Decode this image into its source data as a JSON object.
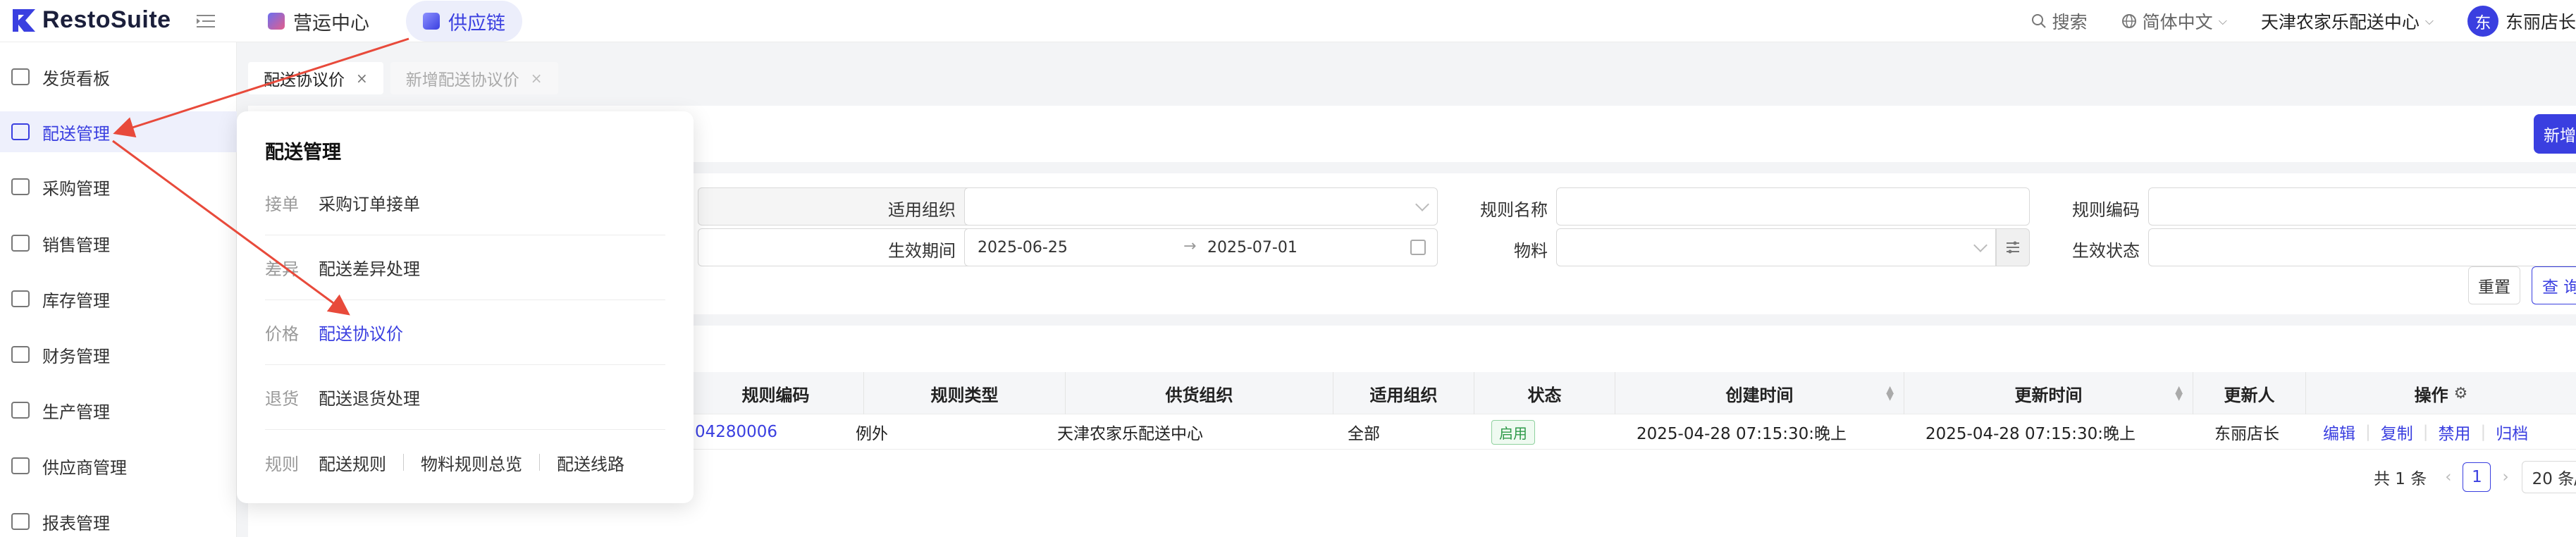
{
  "brand": {
    "name": "RestoSuite",
    "accent": "#3a3fe0"
  },
  "top_nav": [
    {
      "label": "营运中心",
      "icon": "operations-icon",
      "active": false
    },
    {
      "label": "供应链",
      "icon": "supply-chain-icon",
      "active": true
    }
  ],
  "top_right": {
    "search": "搜索",
    "language": "简体中文",
    "org": "天津农家乐配送中心",
    "avatar_char": "东",
    "user": "东丽店长"
  },
  "sidebar": {
    "items": [
      {
        "label": "发货看板",
        "icon": "monitor-icon"
      },
      {
        "label": "配送管理",
        "icon": "truck-icon",
        "active": true
      },
      {
        "label": "采购管理",
        "icon": "cart-icon"
      },
      {
        "label": "销售管理",
        "icon": "bag-icon"
      },
      {
        "label": "库存管理",
        "icon": "warehouse-icon"
      },
      {
        "label": "财务管理",
        "icon": "finance-icon"
      },
      {
        "label": "生产管理",
        "icon": "production-icon"
      },
      {
        "label": "供应商管理",
        "icon": "supplier-icon"
      },
      {
        "label": "报表管理",
        "icon": "report-icon"
      }
    ]
  },
  "tabs": [
    {
      "label": "配送协议价",
      "close": "×",
      "active": true
    },
    {
      "label": "新增配送协议价",
      "close": "×",
      "active": false
    }
  ],
  "new_button": "新增",
  "filters": {
    "apply_org_label": "适用组织",
    "rule_name_label": "规则名称",
    "rule_code_label": "规则编码",
    "effective_period_label": "生效期间",
    "date_start": "2025-06-25",
    "date_sep": "→",
    "date_end": "2025-07-01",
    "material_label": "物料",
    "effective_status_label": "生效状态",
    "reset": "重置",
    "query": "查 询"
  },
  "table": {
    "columns": [
      "规则编码",
      "规则类型",
      "供货组织",
      "适用组织",
      "状态",
      "创建时间",
      "更新时间",
      "更新人",
      "操作"
    ],
    "rows": [
      {
        "rule_code": "04280006",
        "rule_type": "例外",
        "supply_org": "天津农家乐配送中心",
        "apply_org": "全部",
        "status": "启用",
        "created": "2025-04-28 07:15:30:晚上",
        "updated": "2025-04-28 07:15:30:晚上",
        "updater": "东丽店长",
        "actions": [
          "编辑",
          "复制",
          "禁用",
          "归档"
        ]
      }
    ]
  },
  "pagination": {
    "total": "共 1 条",
    "current": "1",
    "page_size": "20 条/"
  },
  "menu_popover": {
    "title": "配送管理",
    "rows": [
      {
        "category": "接单",
        "links": [
          "采购订单接单"
        ]
      },
      {
        "category": "差异",
        "links": [
          "配送差异处理"
        ]
      },
      {
        "category": "价格",
        "links": [
          "配送协议价"
        ],
        "active_link": "配送协议价"
      },
      {
        "category": "退货",
        "links": [
          "配送退货处理"
        ]
      },
      {
        "category": "规则",
        "links": [
          "配送规则",
          "物料规则总览",
          "配送线路"
        ]
      }
    ]
  },
  "annotation_color": "#e84a3b"
}
